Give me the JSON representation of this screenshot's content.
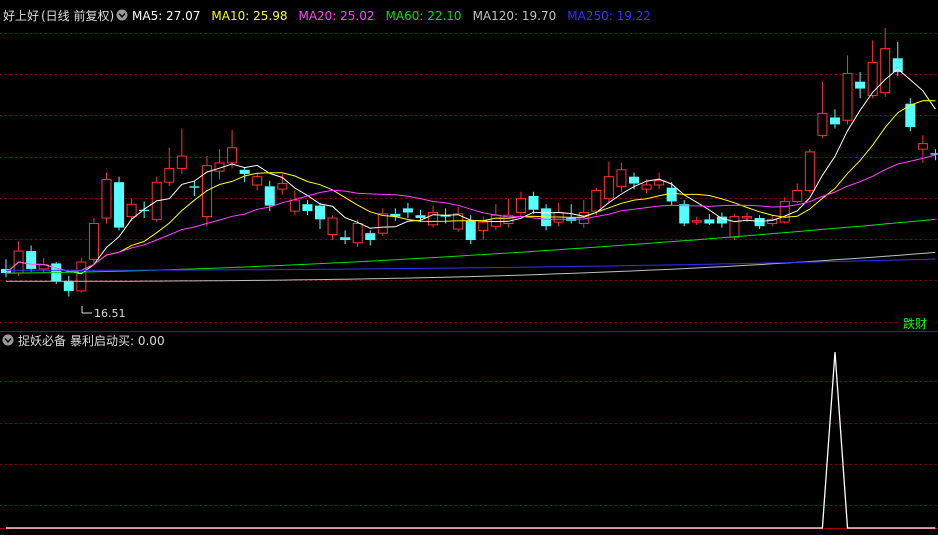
{
  "upper": {
    "stock_title": "好上好",
    "period_label": "(日线 前复权)",
    "ma_legend": [
      {
        "label": "MA5: 27.07",
        "color": "#ffffff"
      },
      {
        "label": "MA10: 25.98",
        "color": "#ffff00"
      },
      {
        "label": "MA20: 25.02",
        "color": "#ff40ff"
      },
      {
        "label": "MA60: 22.10",
        "color": "#00e000"
      },
      {
        "label": "MA120: 19.70",
        "color": "#c0c0c0"
      },
      {
        "label": "MA250: 19.22",
        "color": "#3030ff"
      }
    ],
    "low_marker": "16.51",
    "corner_tag": "跌财"
  },
  "lower": {
    "indicator_name": "捉妖必备",
    "indicator_value": "暴利启动买: 0.00"
  },
  "colors": {
    "up": "#ff3232",
    "down": "#54ffff",
    "grid": "#8b0000",
    "panel_border": "#a00000",
    "title_text": "#dcdcdc",
    "tag": "#00ff00",
    "signal_line": "#ffffff"
  },
  "chart_data": [
    {
      "type": "candlestick",
      "price_range": [
        14.5,
        36.0
      ],
      "candles": [
        [
          18.5,
          18.2,
          19.2,
          17.9
        ],
        [
          18.2,
          19.8,
          20.5,
          18.0
        ],
        [
          19.8,
          18.5,
          20.2,
          18.3
        ],
        [
          18.5,
          18.8,
          19.3,
          18.2
        ],
        [
          18.9,
          17.6,
          19.0,
          17.4
        ],
        [
          17.6,
          16.9,
          18.0,
          16.5
        ],
        [
          16.9,
          19.0,
          19.3,
          16.8
        ],
        [
          19.2,
          21.8,
          22.2,
          18.8
        ],
        [
          22.2,
          25.0,
          25.5,
          21.8
        ],
        [
          24.8,
          21.5,
          25.2,
          21.3
        ],
        [
          22.3,
          23.2,
          23.6,
          22.0
        ],
        [
          22.8,
          22.7,
          23.4,
          22.2
        ],
        [
          22.1,
          24.8,
          25.2,
          21.9
        ],
        [
          24.8,
          25.8,
          27.3,
          24.5
        ],
        [
          25.8,
          26.7,
          28.7,
          25.4
        ],
        [
          24.5,
          24.4,
          24.9,
          23.8
        ],
        [
          22.3,
          26.0,
          26.7,
          21.6
        ],
        [
          25.6,
          26.2,
          27.2,
          25.0
        ],
        [
          26.2,
          27.3,
          28.6,
          25.8
        ],
        [
          25.7,
          25.4,
          25.9,
          24.8
        ],
        [
          24.6,
          25.2,
          25.4,
          24.2
        ],
        [
          24.5,
          23.1,
          24.9,
          22.7
        ],
        [
          24.3,
          24.7,
          25.4,
          23.9
        ],
        [
          22.7,
          23.5,
          24.2,
          22.4
        ],
        [
          23.2,
          22.7,
          23.5,
          22.4
        ],
        [
          23.1,
          22.1,
          23.3,
          21.4
        ],
        [
          21.0,
          22.2,
          22.4,
          20.6
        ],
        [
          20.8,
          20.6,
          21.3,
          20.3
        ],
        [
          20.4,
          21.8,
          22.1,
          20.1
        ],
        [
          21.1,
          20.6,
          21.3,
          20.2
        ],
        [
          21.1,
          22.5,
          22.9,
          20.9
        ],
        [
          22.5,
          22.3,
          22.9,
          22.0
        ],
        [
          22.9,
          22.6,
          23.3,
          22.2
        ],
        [
          22.4,
          22.2,
          22.8,
          21.9
        ],
        [
          21.7,
          22.6,
          23.1,
          21.5
        ],
        [
          22.4,
          22.3,
          22.9,
          21.8
        ],
        [
          21.4,
          22.5,
          23.0,
          21.2
        ],
        [
          22.0,
          20.6,
          22.4,
          20.3
        ],
        [
          21.3,
          21.9,
          22.3,
          20.6
        ],
        [
          21.6,
          22.4,
          23.2,
          21.3
        ],
        [
          21.8,
          22.4,
          23.6,
          21.5
        ],
        [
          22.6,
          23.6,
          24.1,
          22.3
        ],
        [
          23.8,
          22.8,
          24.1,
          22.5
        ],
        [
          22.9,
          21.6,
          23.2,
          21.3
        ],
        [
          21.9,
          22.6,
          23.3,
          21.6
        ],
        [
          22.2,
          22.0,
          23.2,
          21.8
        ],
        [
          21.8,
          22.6,
          23.5,
          21.5
        ],
        [
          22.7,
          24.2,
          24.4,
          22.4
        ],
        [
          23.6,
          25.2,
          26.3,
          23.3
        ],
        [
          24.5,
          25.7,
          26.2,
          24.1
        ],
        [
          25.2,
          24.7,
          25.5,
          24.3
        ],
        [
          24.3,
          24.6,
          25.0,
          24.0
        ],
        [
          24.6,
          24.9,
          25.5,
          24.3
        ],
        [
          24.4,
          23.4,
          24.8,
          23.1
        ],
        [
          23.2,
          21.8,
          23.5,
          21.6
        ],
        [
          21.9,
          22.0,
          22.3,
          21.7
        ],
        [
          22.1,
          21.8,
          22.5,
          21.7
        ],
        [
          22.3,
          21.8,
          22.6,
          21.5
        ],
        [
          20.8,
          22.3,
          22.5,
          20.6
        ],
        [
          22.2,
          22.3,
          22.6,
          21.9
        ],
        [
          22.2,
          21.6,
          22.4,
          21.4
        ],
        [
          21.8,
          22.1,
          22.4,
          21.6
        ],
        [
          21.9,
          23.4,
          23.7,
          21.8
        ],
        [
          23.4,
          24.2,
          24.7,
          23.3
        ],
        [
          24.2,
          27.0,
          27.2,
          24.0
        ],
        [
          28.2,
          29.8,
          32.1,
          28.0
        ],
        [
          29.5,
          29.0,
          30.1,
          28.7
        ],
        [
          29.3,
          32.7,
          34.0,
          29.0
        ],
        [
          32.1,
          31.6,
          32.8,
          30.9
        ],
        [
          31.1,
          33.5,
          35.1,
          30.9
        ],
        [
          31.3,
          34.5,
          36.0,
          31.0
        ],
        [
          33.8,
          32.8,
          35.0,
          32.5
        ],
        [
          30.5,
          28.8,
          30.9,
          28.5
        ],
        [
          27.2,
          27.6,
          28.2,
          26.2
        ],
        [
          26.9,
          26.8,
          27.2,
          26.4
        ]
      ],
      "ma_last_values": {
        "MA5": 27.07,
        "MA10": 25.98,
        "MA20": 25.02,
        "MA60": 22.1,
        "MA120": 19.7,
        "MA250": 19.22
      }
    },
    {
      "type": "line",
      "name": "暴利启动买",
      "y_range": [
        0,
        1
      ],
      "values": [
        0,
        0,
        0,
        0,
        0,
        0,
        0,
        0,
        0,
        0,
        0,
        0,
        0,
        0,
        0,
        0,
        0,
        0,
        0,
        0,
        0,
        0,
        0,
        0,
        0,
        0,
        0,
        0,
        0,
        0,
        0,
        0,
        0,
        0,
        0,
        0,
        0,
        0,
        0,
        0,
        0,
        0,
        0,
        0,
        0,
        0,
        0,
        0,
        0,
        0,
        0,
        0,
        0,
        0,
        0,
        0,
        0,
        0,
        0,
        0,
        0,
        0,
        0,
        0,
        0,
        0,
        1,
        0,
        0,
        0,
        0,
        0,
        0,
        0,
        0
      ]
    }
  ]
}
